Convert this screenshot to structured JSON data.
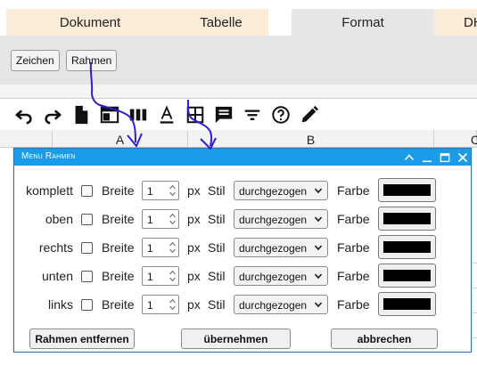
{
  "tabs": [
    {
      "label": "Dokument",
      "active": false
    },
    {
      "label": "Tabelle",
      "active": false
    },
    {
      "label": "Format",
      "active": true
    },
    {
      "label": "DH",
      "active": false
    }
  ],
  "ribbon": {
    "zeichen_label": "Zeichen",
    "rahmen_label": "Rahmen"
  },
  "toolbar": {
    "icons": [
      "undo-icon",
      "redo-icon",
      "document-icon",
      "window-icon",
      "columns-icon",
      "text-color-icon",
      "table-grid-icon",
      "comment-icon",
      "filter-icon",
      "help-icon",
      "pencil-icon"
    ]
  },
  "sheet": {
    "col_a": "A",
    "col_b": "B",
    "col_c": "C",
    "side_cells": [
      "",
      "",
      "",
      "",
      "",
      ""
    ]
  },
  "dialog": {
    "title": "Menu Rahmen",
    "rows": [
      {
        "side": "komplett",
        "checked": false,
        "breite_label": "Breite",
        "width_value": "1",
        "unit": "px",
        "stil_label": "Stil",
        "style_value": "durchgezogen",
        "farbe_label": "Farbe",
        "color": "#000000"
      },
      {
        "side": "oben",
        "checked": false,
        "breite_label": "Breite",
        "width_value": "1",
        "unit": "px",
        "stil_label": "Stil",
        "style_value": "durchgezogen",
        "farbe_label": "Farbe",
        "color": "#000000"
      },
      {
        "side": "rechts",
        "checked": false,
        "breite_label": "Breite",
        "width_value": "1",
        "unit": "px",
        "stil_label": "Stil",
        "style_value": "durchgezogen",
        "farbe_label": "Farbe",
        "color": "#000000"
      },
      {
        "side": "unten",
        "checked": false,
        "breite_label": "Breite",
        "width_value": "1",
        "unit": "px",
        "stil_label": "Stil",
        "style_value": "durchgezogen",
        "farbe_label": "Farbe",
        "color": "#000000"
      },
      {
        "side": "links",
        "checked": false,
        "breite_label": "Breite",
        "width_value": "1",
        "unit": "px",
        "stil_label": "Stil",
        "style_value": "durchgezogen",
        "farbe_label": "Farbe",
        "color": "#000000"
      }
    ],
    "buttons": {
      "remove": "Rahmen entfernen",
      "apply": "übernehmen",
      "cancel": "abbrechen"
    }
  },
  "colors": {
    "tab_bg": "#fcebd6",
    "tab_active_bg": "#e7e7e7",
    "titlebar": "#1a9ce8",
    "annotation": "#2d1fd6"
  }
}
